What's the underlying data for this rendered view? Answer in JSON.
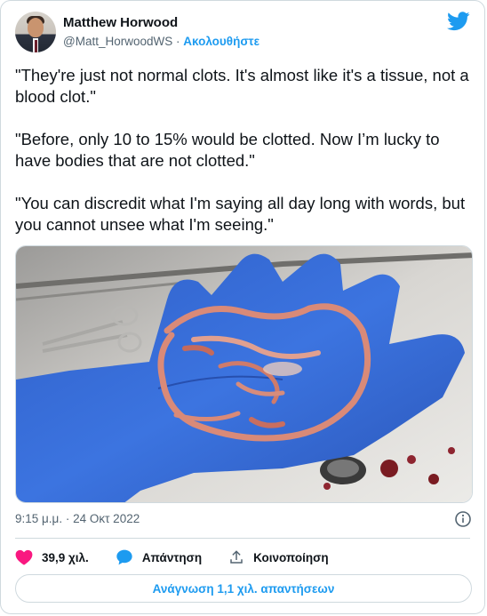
{
  "author": {
    "name": "Matthew Horwood",
    "handle": "@Matt_HorwoodWS",
    "separator": " · ",
    "follow_label": "Ακολουθήστε"
  },
  "tweet": {
    "paragraphs": [
      "\"They're just not normal clots. It's almost like it's a tissue, not a blood clot.\"",
      "\"Before, only 10 to 15% would be clotted. Now I’m lucky to have bodies that are not clotted.\"",
      "\"You can discredit what I'm saying all day long with words, but you cannot unsee what I'm seeing.\""
    ],
    "timestamp": "9:15 μ.μ. · 24 Οκτ 2022"
  },
  "actions": {
    "like_count": "39,9 χιλ.",
    "reply_label": "Απάντηση",
    "share_label": "Κοινοποίηση"
  },
  "read_replies_label": "Ανάγνωση 1,1 χιλ. απαντήσεων",
  "icons": {
    "brand": "twitter-bird-icon",
    "like": "heart-icon",
    "reply": "speech-bubble-icon",
    "share": "upload-icon",
    "info": "info-icon"
  },
  "colors": {
    "accent": "#1d9bf0",
    "like": "#f91880",
    "text": "#0f1419",
    "secondary": "#536471",
    "border": "#cfd9de"
  }
}
